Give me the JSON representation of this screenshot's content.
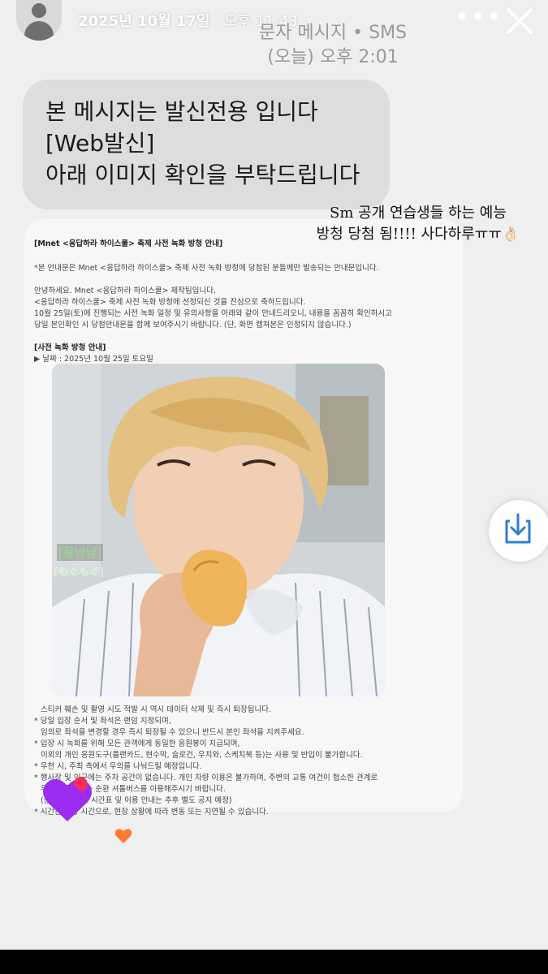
{
  "story": {
    "date": "2025년 10월 17일",
    "time": "오후 11:43"
  },
  "sms": {
    "header": "문자 메시지 • SMS",
    "date": "(오늘) 오후 2:01",
    "bubble_lines": [
      "본 메시지는 발신전용 입니다",
      "[Web발신]",
      "아래 이미지 확인을 부탁드립니다"
    ]
  },
  "caption": {
    "line1": "Sm 공개 연습생들 하는 예능",
    "line2": "방청 당첨 됨!!!! 사다하루ㅠㅠ👌🏻"
  },
  "doc": {
    "title": "[Mnet <응답하라 하이스쿨> 축제 사전 녹화 방청 안내]",
    "lines": [
      "*본 안내문은 Mnet <응답하라 하이스쿨> 축제 사전 녹화 방청에 당첨된 분들께만 발송되는 안내문입니다.",
      "안녕하세요. Mnet <응답하라 하이스쿨> 제작팀입니다.",
      "<응답하라 하이스쿨> 축제 사전 녹화 방청에 선정되신 것을 진심으로 축하드립니다.",
      "10월 25일(토)에 진행되는 사전 녹화 일정 및 유의사항을 아래와 같이 안내드리오니, 내용을 꼼꼼히 확인하시고",
      "당일 본인확인 시 당첨안내문을 함께 보여주시기 바랍니다. (단, 화면 캡쳐본은 인정되지 않습니다.)",
      "[사전 녹화 방청 안내]",
      "▶ 날짜 : 2025년 10월 25일 토요일",
      "스티커 훼손 및 촬영 시도 적발 시 역시 데이터 삭제 및 즉시 퇴장됩니다.",
      "* 당일 입장 순서 및 좌석은 랜덤 지정되며,",
      "임의로 좌석을 변경할 경우 즉시 퇴장될 수 있으니 반드시 본인 좌석을 지켜주세요.",
      "* 입장 시 녹화를 위해 모든 관객에게 동일한 응원봉이 지급되며,",
      "이외의 개인 응원도구(플랜카드, 현수막, 슬로건, 우치와, 스케치북 등)는 사용 및 반입이 불가합니다.",
      "* 우천 시, 주최 측에서 우의를 나눠드릴 예정입니다.",
      "* 행사장 및 인근에는 주차 공간이 없습니다. 개인 차량 이용은 불가하며, 주변의 교통 여건이 협소한 관계로",
      "무료로 운영되는 순환 셔틀버스를 이용해주시기 바랍니다.",
      "(운영 셔틀버스 시간표 및 이용 안내는 추후 별도 공지 예정)",
      "* 시간은 예상 시간으로, 현장 상황에 따라 변동 또는 지연될 수 있습니다."
    ]
  },
  "photo": {
    "label1": "[몽냥냠]",
    "label2": "(もぐもぐ)"
  },
  "icons": {
    "avatar": "profile-avatar",
    "more": "more-icon",
    "close": "close-icon",
    "download": "download-icon",
    "heart": "heart-icon"
  },
  "colors": {
    "bubble": "#dddddd",
    "download_accent": "#2d7fd3",
    "heart_purple": "#9b2df0",
    "heart_red": "#ff2b55"
  }
}
